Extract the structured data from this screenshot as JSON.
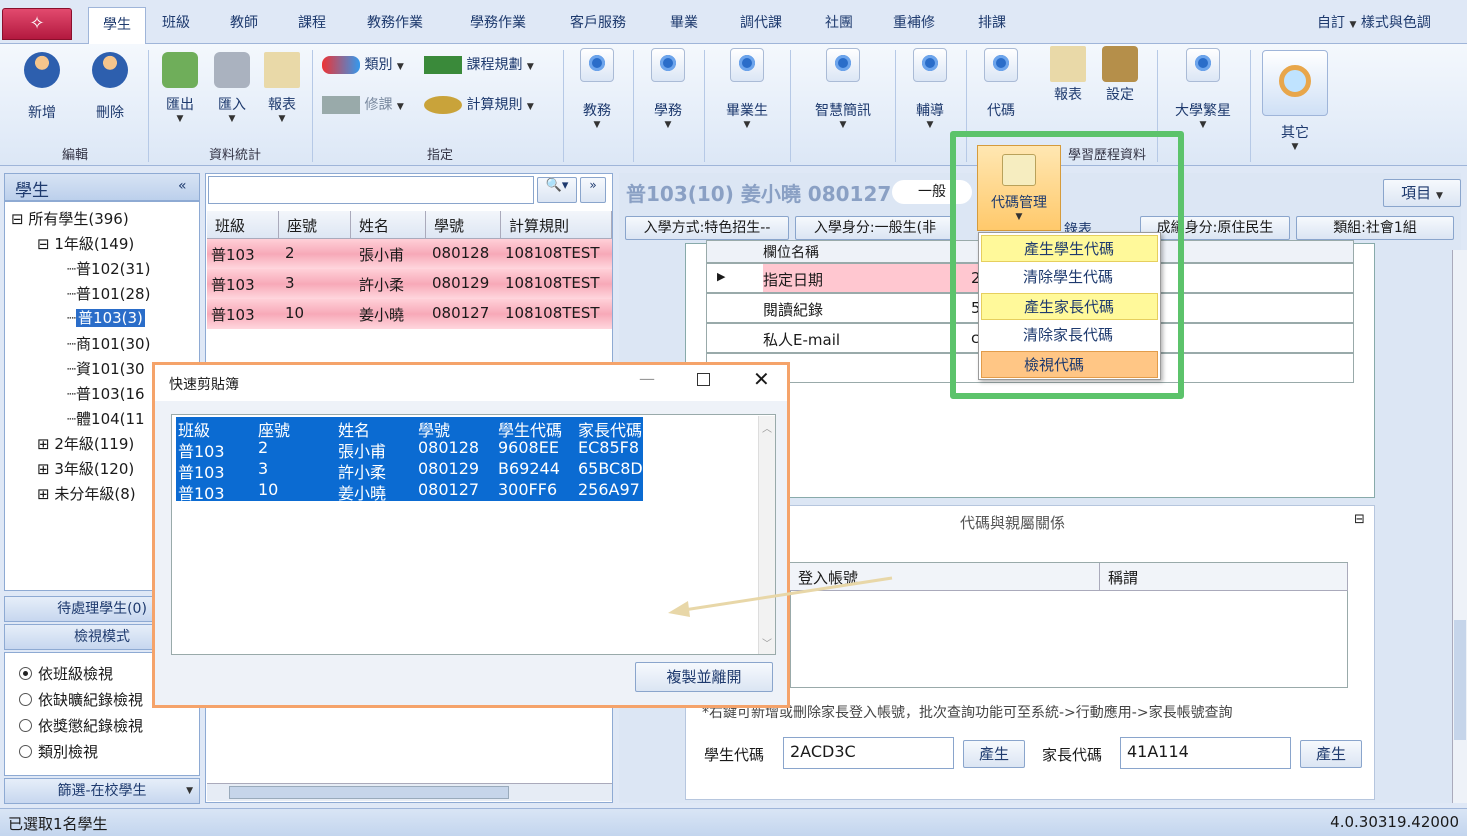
{
  "app_tab": "✧",
  "tabs": [
    "學生",
    "班級",
    "教師",
    "課程",
    "教務作業",
    "學務作業",
    "客戶服務",
    "畢業",
    "調代課",
    "社團",
    "重補修",
    "排課"
  ],
  "tabs_right": {
    "custom": "自訂",
    "style": "樣式與色調"
  },
  "ribbon": {
    "add": "新增",
    "delete": "刪除",
    "group_edit": "編輯",
    "export": "匯出",
    "import": "匯入",
    "report": "報表",
    "group_stats": "資料統計",
    "category": "類別",
    "course_plan": "課程規劃",
    "elective": "修課",
    "calc_rule": "計算規則",
    "group_assign": "指定",
    "academic": "教務",
    "student_affairs": "學務",
    "graduate": "畢業生",
    "smart_msg": "智慧簡訊",
    "guidance": "輔導",
    "code": "代碼",
    "report2": "報表",
    "settings": "設定",
    "univ_star": "大學繁星",
    "other": "其它",
    "code_mgmt": "代碼管理",
    "learning_history": "學習歷程資料"
  },
  "left_panel": {
    "title": "學生",
    "collapse": "«",
    "tree": [
      "所有學生(396)",
      "1年級(149)",
      "普102(31)",
      "普101(28)",
      "普103(3)",
      "商101(30)",
      "資101(30",
      "普103(16",
      "體104(11",
      "2年級(119)",
      "3年級(120)",
      "未分年級(8)"
    ],
    "pending": "待處理學生(0)",
    "view_mode": "檢視模式",
    "radios": [
      "依班級檢視",
      "依缺曠紀錄檢視",
      "依獎懲紀錄檢視",
      "類別檢視"
    ],
    "filter": "篩選-在校學生"
  },
  "search": {
    "placeholder": ""
  },
  "student_grid": {
    "columns": [
      "班級",
      "座號",
      "姓名",
      "學號",
      "計算規則"
    ],
    "rows": [
      [
        "普103",
        "2",
        "張小甫",
        "080128",
        "108108TEST"
      ],
      [
        "普103",
        "3",
        "許小柔",
        "080129",
        "108108TEST"
      ],
      [
        "普103",
        "10",
        "姜小曉",
        "080127",
        "108108TEST"
      ]
    ]
  },
  "detail": {
    "header": "普103(10) 姜小曉 080127",
    "badge": "一般",
    "items_btn": "項目",
    "info_tags": [
      "入學方式:特色招生--",
      "入學身分:一般生(非",
      "成績身分:原住民生",
      "類組:社會1組",
      "錄表"
    ],
    "fields_header": "欄位名稱",
    "fields": [
      "指定日期",
      "閱讀紀錄",
      "私人E-mail"
    ],
    "field_values": [
      "2",
      "5",
      "c"
    ],
    "section_title": "代碼與親屬關係",
    "relation_cols": [
      "登入帳號",
      "稱謂"
    ],
    "note": "*右鍵可新增或刪除家長登入帳號，批次查詢功能可至系統->行動應用->家長帳號查詢",
    "student_code_label": "學生代碼",
    "student_code": "2ACD3C",
    "parent_code_label": "家長代碼",
    "parent_code": "41A114",
    "gen": "產生"
  },
  "code_menu": [
    "產生學生代碼",
    "清除學生代碼",
    "產生家長代碼",
    "清除家長代碼",
    "檢視代碼"
  ],
  "dialog": {
    "title": "快速剪貼簿",
    "header": [
      "班級",
      "座號",
      "姓名",
      "學號",
      "學生代碼",
      "家長代碼"
    ],
    "rows": [
      [
        "普103",
        "2",
        "張小甫",
        "080128",
        "9608EE",
        "EC85F8"
      ],
      [
        "普103",
        "3",
        "許小柔",
        "080129",
        "B69244",
        "65BC8D"
      ],
      [
        "普103",
        "10",
        "姜小曉",
        "080127",
        "300FF6",
        "256A97"
      ]
    ],
    "copy_close": "複製並離開"
  },
  "status": {
    "left": "已選取1名學生",
    "version": "4.0.30319.42000"
  }
}
